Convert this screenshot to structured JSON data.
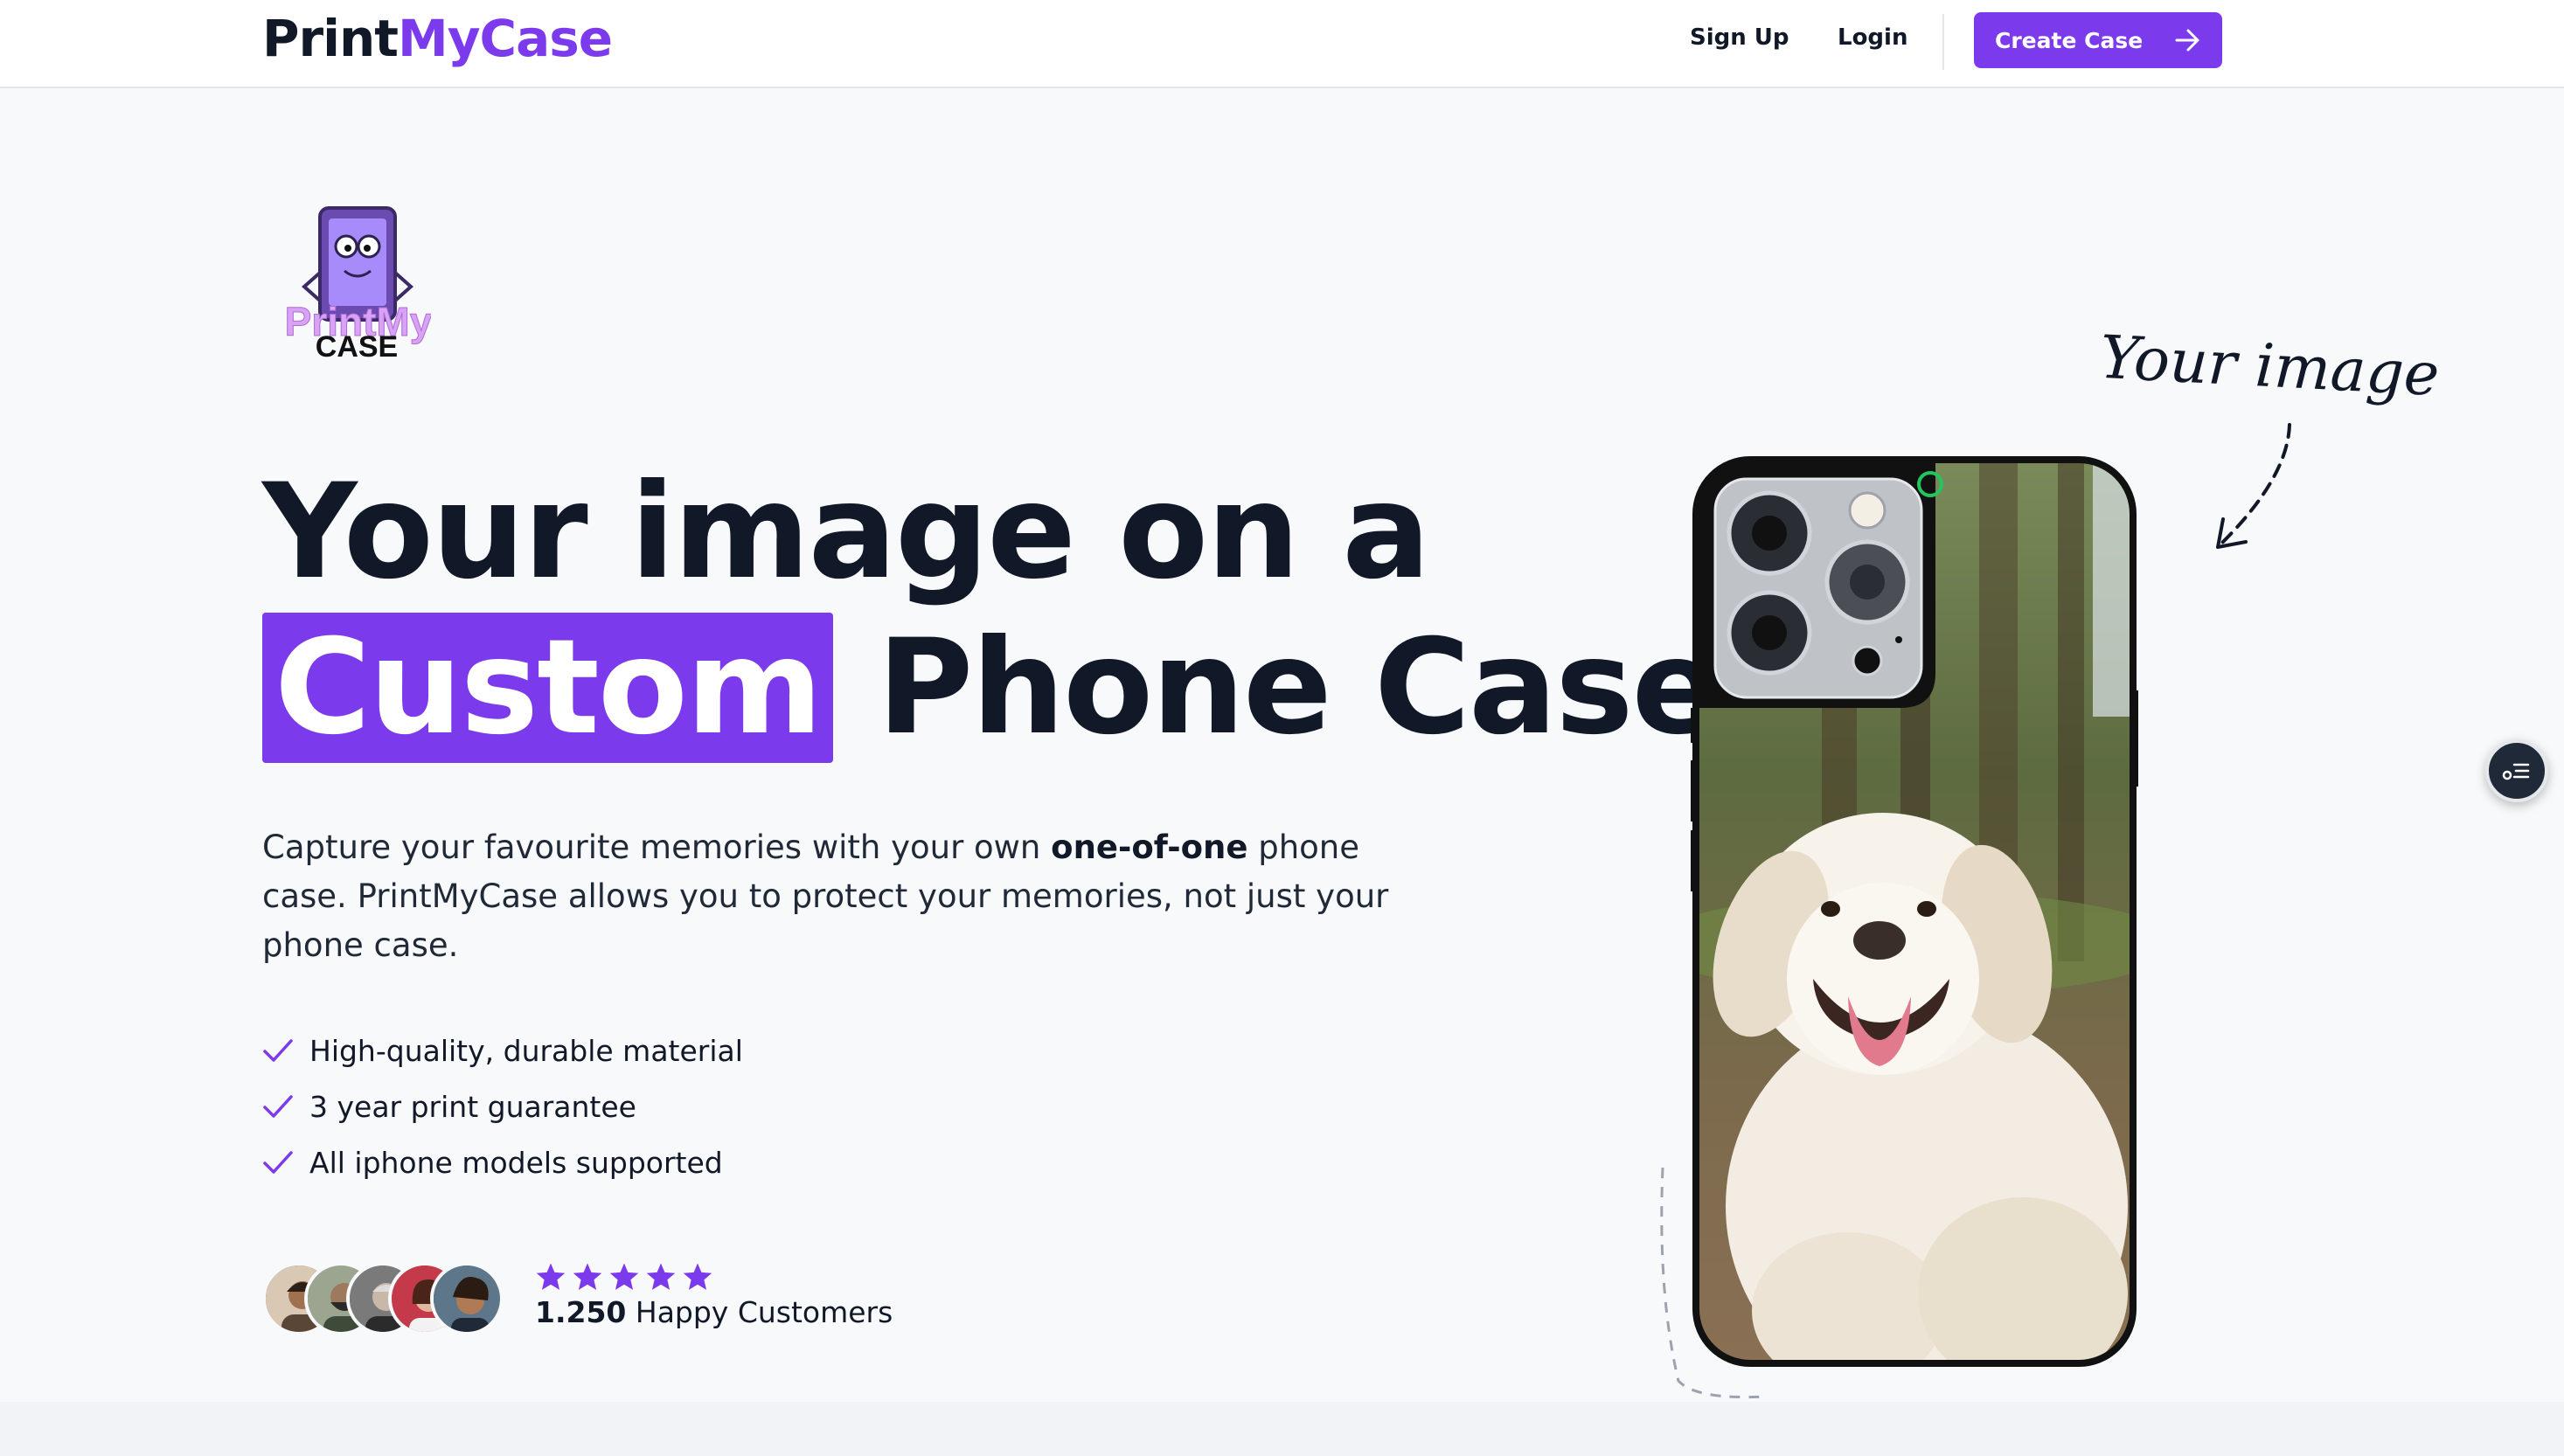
{
  "nav": {
    "logo_part1": "Print",
    "logo_part2": "MyCase",
    "signup": "Sign Up",
    "login": "Login",
    "cta": "Create Case",
    "cta_icon": "arrow-right-icon"
  },
  "hero": {
    "brand_logo": {
      "text_top": "PrintMy",
      "text_bottom": "CASE"
    },
    "headline_line1": "Your image on a",
    "headline_highlight": "Custom",
    "headline_rest": " Phone Case",
    "sub_part1": "Capture your favourite memories with your own ",
    "sub_bold": "one-of-one",
    "sub_part2": " phone case. PrintMyCase allows you to protect your memories, not just your phone case.",
    "features": [
      "High-quality, durable material",
      "3 year print guarantee",
      "All iphone models supported"
    ],
    "rating_stars": 5,
    "customers_count": "1.250",
    "customers_label": " Happy Customers",
    "handwritten": "Your image"
  },
  "colors": {
    "accent": "#7c3aed",
    "text": "#111827",
    "background": "#f8f9fb"
  }
}
